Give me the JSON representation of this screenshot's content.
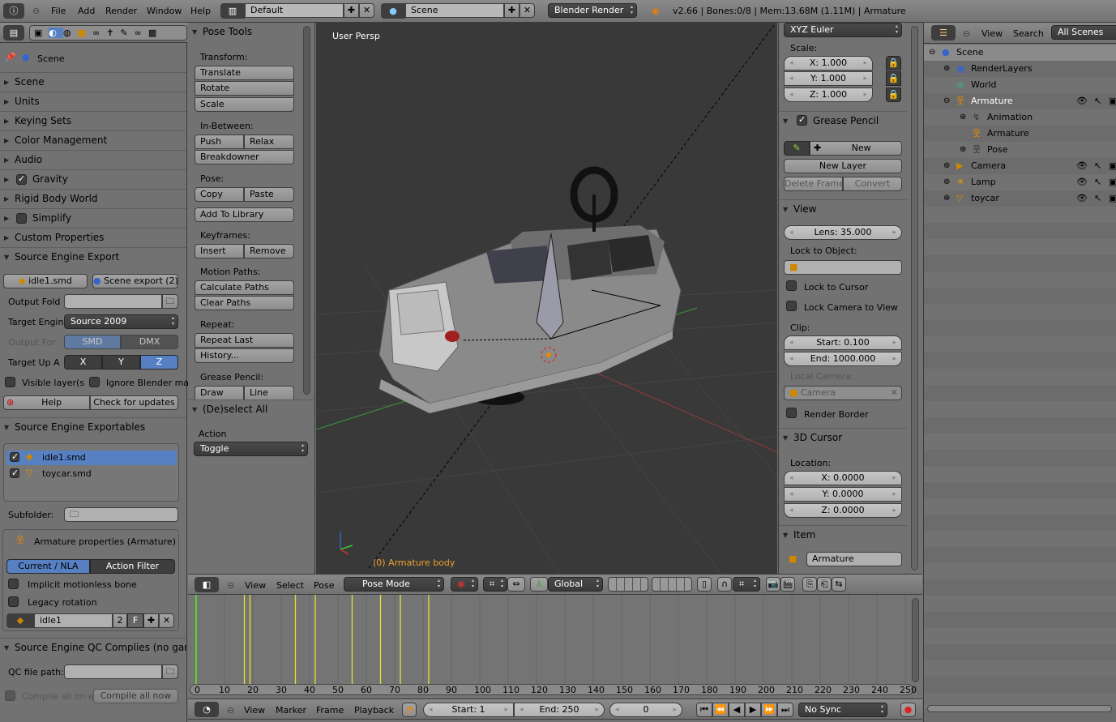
{
  "top_bar": {
    "menus": [
      "File",
      "Add",
      "Render",
      "Window",
      "Help"
    ],
    "layout": "Default",
    "scene": "Scene",
    "engine": "Blender Render",
    "info": "v2.66 | Bones:0/8 | Mem:13.68M (1.11M) | Armature"
  },
  "properties": {
    "context": "Scene",
    "collapsed_panels": [
      "Scene",
      "Units",
      "Keying Sets",
      "Color Management",
      "Audio",
      "Gravity",
      "Rigid Body World",
      "Simplify",
      "Custom Properties"
    ],
    "export": {
      "title": "Source Engine Export",
      "idle_btn": "idle1.smd",
      "scene_btn": "Scene export (2)",
      "output_folder": "Output Fold",
      "target_engine": "Target Engin",
      "engine_value": "Source 2009",
      "output_format": "Output For",
      "fmt_smd": "SMD",
      "fmt_dmx": "DMX",
      "target_up": "Target Up A",
      "axes": [
        "X",
        "Y",
        "Z"
      ],
      "selected_axis": "Z",
      "visible_layers": "Visible layer(s",
      "ignore_materials": "Ignore Blender ma",
      "help": "Help",
      "check_updates": "Check for updates"
    },
    "exportables": {
      "title": "Source Engine Exportables",
      "items": [
        {
          "name": "idle1.smd",
          "checked": true,
          "selected": true
        },
        {
          "name": "toycar.smd",
          "checked": true,
          "selected": false
        }
      ],
      "subfolder": "Subfolder:"
    },
    "armature_box": {
      "title": "Armature properties (Armature)",
      "tab_current": "Current / NLA",
      "tab_filter": "Action Filter",
      "implicit": "Implicit motionless bone",
      "legacy": "Legacy rotation",
      "action": "idle1",
      "users": "2",
      "fake": "F"
    },
    "qc": {
      "title": "Source Engine QC Complies (no game",
      "path_label": "QC file path:",
      "compile_on_export": "Compile all on e",
      "compile_now": "Compile all now"
    }
  },
  "toolshelf": {
    "title": "Pose Tools",
    "sections": {
      "transform": "Transform:",
      "translate": "Translate",
      "rotate": "Rotate",
      "scale": "Scale",
      "inbetween": "In-Between:",
      "push": "Push",
      "relax": "Relax",
      "breakdowner": "Breakdowner",
      "pose": "Pose:",
      "copy": "Copy",
      "paste": "Paste",
      "add_library": "Add To Library",
      "keyframes": "Keyframes:",
      "insert": "Insert",
      "remove": "Remove",
      "motion_paths": "Motion Paths:",
      "calc_paths": "Calculate Paths",
      "clear_paths": "Clear Paths",
      "repeat": "Repeat:",
      "repeat_last": "Repeat Last",
      "history": "History...",
      "grease": "Grease Pencil:",
      "draw": "Draw",
      "line": "Line"
    },
    "operator": {
      "title": "(De)select All",
      "action_label": "Action",
      "action_value": "Toggle"
    }
  },
  "viewport": {
    "view_name": "User Persp",
    "object_info": "(0) Armature body",
    "info_color": "#f0a030"
  },
  "npanel": {
    "rotation_mode": "XYZ Euler",
    "scale_label": "Scale:",
    "scale": [
      "X: 1.000",
      "Y: 1.000",
      "Z: 1.000"
    ],
    "grease_title": "Grease Pencil",
    "gp_new": "New",
    "gp_new_layer": "New Layer",
    "gp_delete": "Delete Frame",
    "gp_convert": "Convert",
    "view_title": "View",
    "lens": "Lens: 35.000",
    "lock_object": "Lock to Object:",
    "lock_cursor": "Lock to Cursor",
    "lock_camera": "Lock Camera to View",
    "clip": "Clip:",
    "clip_start": "Start: 0.100",
    "clip_end": "End: 1000.000",
    "local_camera": "Local Camera:",
    "camera": "Camera",
    "render_border": "Render Border",
    "cursor_title": "3D Cursor",
    "location": "Location:",
    "cursor": [
      "X: 0.0000",
      "Y: 0.0000",
      "Z: 0.0000"
    ],
    "item_title": "Item",
    "item_name": "Armature"
  },
  "view3d_header": {
    "menus": [
      "View",
      "Select",
      "Pose"
    ],
    "mode": "Pose Mode",
    "orientation": "Global"
  },
  "outliner": {
    "menus": [
      "View",
      "Search"
    ],
    "filter": "All Scenes",
    "rows": [
      {
        "name": "Scene",
        "level": 0,
        "exp": "-"
      },
      {
        "name": "RenderLayers",
        "level": 1,
        "exp": "+"
      },
      {
        "name": "World",
        "level": 1,
        "exp": ""
      },
      {
        "name": "Armature",
        "level": 1,
        "exp": "-",
        "active": true,
        "vis": true
      },
      {
        "name": "Animation",
        "level": 2,
        "exp": "+"
      },
      {
        "name": "Armature",
        "level": 2,
        "exp": ""
      },
      {
        "name": "Pose",
        "level": 2,
        "exp": "+"
      },
      {
        "name": "Camera",
        "level": 1,
        "exp": "+",
        "vis": true
      },
      {
        "name": "Lamp",
        "level": 1,
        "exp": "+",
        "vis": true
      },
      {
        "name": "toycar",
        "level": 1,
        "exp": "+",
        "vis": true
      }
    ]
  },
  "timeline": {
    "ticks": [
      "0",
      "10",
      "20",
      "30",
      "40",
      "50",
      "60",
      "70",
      "80",
      "90",
      "100",
      "110",
      "120",
      "130",
      "140",
      "150",
      "160",
      "170",
      "180",
      "190",
      "200",
      "210",
      "220",
      "230",
      "240",
      "250"
    ],
    "current_frame_marker": 0,
    "keyframes": [
      17,
      19,
      35,
      42,
      55,
      65,
      72,
      82
    ],
    "menus": [
      "View",
      "Marker",
      "Frame",
      "Playback"
    ],
    "start": "Start: 1",
    "end": "End: 250",
    "current": "0",
    "sync": "No Sync"
  }
}
